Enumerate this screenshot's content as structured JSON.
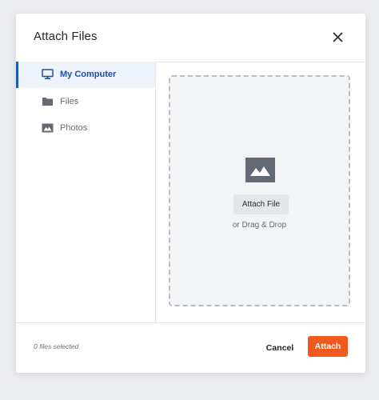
{
  "dialog": {
    "title": "Attach Files"
  },
  "sidebar": {
    "items": [
      {
        "label": "My Computer",
        "icon": "monitor-icon",
        "active": true
      },
      {
        "label": "Files",
        "icon": "folder-icon",
        "active": false
      },
      {
        "label": "Photos",
        "icon": "image-icon",
        "active": false
      }
    ]
  },
  "dropzone": {
    "icon": "image-placeholder-icon",
    "button_label": "Attach File",
    "hint": "or Drag & Drop"
  },
  "footer": {
    "status": "0 files selected",
    "cancel_label": "Cancel",
    "attach_label": "Attach"
  },
  "colors": {
    "accent_blue": "#1f58c3",
    "active_bg": "#eef2fb",
    "attach_orange": "#f05a1e",
    "icon_gray": "#636a74"
  }
}
